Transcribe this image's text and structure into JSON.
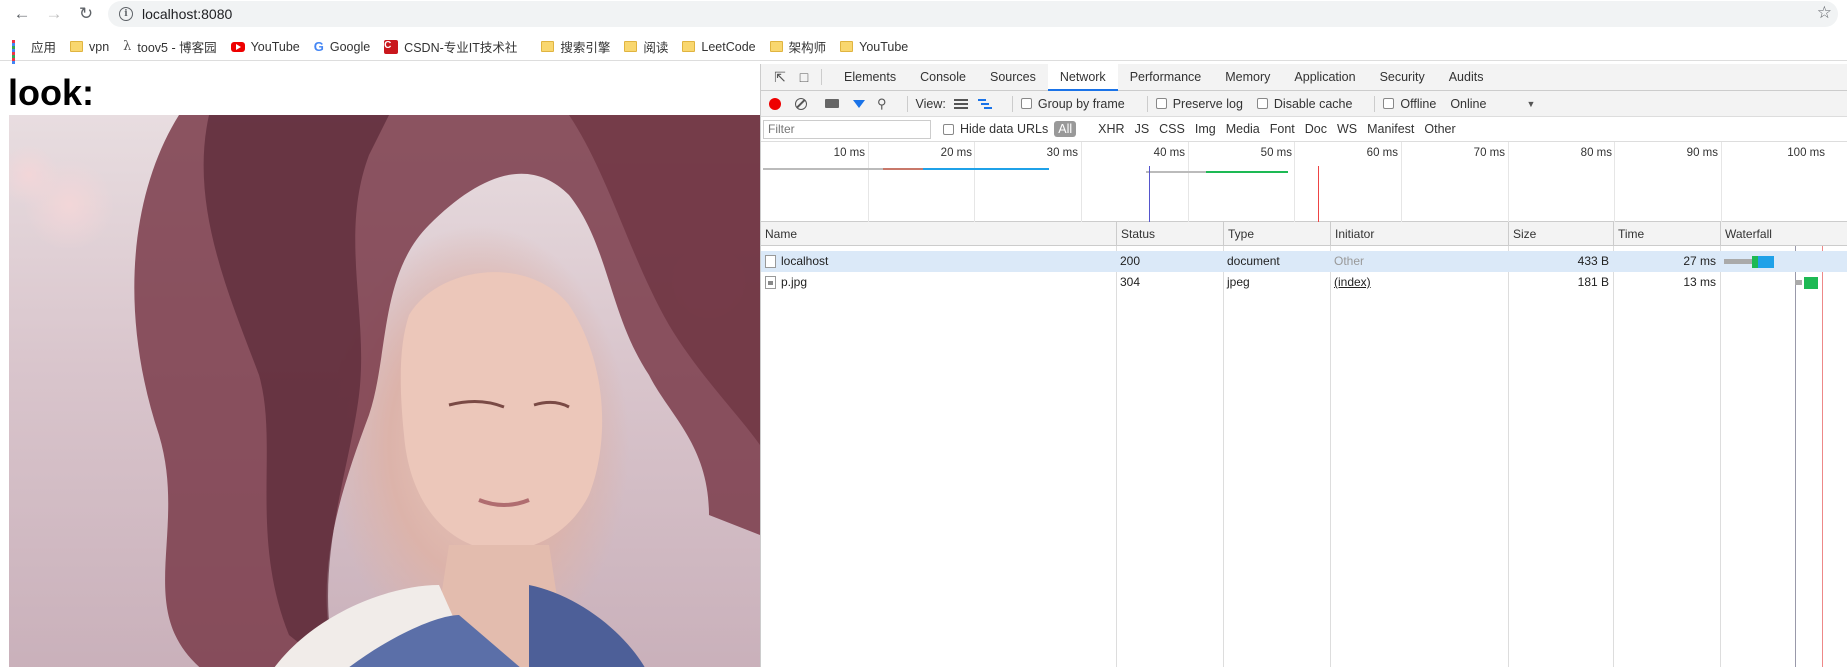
{
  "browser": {
    "url": "localhost:8080",
    "bookmarks": [
      {
        "label": "应用",
        "icon": "apps-icon"
      },
      {
        "label": "vpn",
        "icon": "folder-icon"
      },
      {
        "label": "toov5 - 博客园",
        "icon": "toov-icon"
      },
      {
        "label": "YouTube",
        "icon": "youtube-icon"
      },
      {
        "label": "Google",
        "icon": "google-icon"
      },
      {
        "label": "CSDN-专业IT技术社",
        "icon": "csdn-icon"
      },
      {
        "label": "搜索引擎",
        "icon": "folder-icon"
      },
      {
        "label": "阅读",
        "icon": "folder-icon"
      },
      {
        "label": "LeetCode",
        "icon": "folder-icon"
      },
      {
        "label": "架构师",
        "icon": "folder-icon"
      },
      {
        "label": "YouTube",
        "icon": "folder-icon"
      }
    ]
  },
  "page": {
    "heading": "look:"
  },
  "devtools": {
    "tabs": [
      "Elements",
      "Console",
      "Sources",
      "Network",
      "Performance",
      "Memory",
      "Application",
      "Security",
      "Audits"
    ],
    "active_tab": "Network",
    "controls": {
      "view_label": "View:",
      "group_by_frame": "Group by frame",
      "preserve_log": "Preserve log",
      "disable_cache": "Disable cache",
      "offline": "Offline",
      "throttling": "Online"
    },
    "filter": {
      "placeholder": "Filter",
      "hide_data_urls": "Hide data URLs",
      "types": [
        "All",
        "XHR",
        "JS",
        "CSS",
        "Img",
        "Media",
        "Font",
        "Doc",
        "WS",
        "Manifest",
        "Other"
      ]
    },
    "timeline_ticks": [
      "10 ms",
      "20 ms",
      "30 ms",
      "40 ms",
      "50 ms",
      "60 ms",
      "70 ms",
      "80 ms",
      "90 ms",
      "100 ms"
    ],
    "columns": [
      "Name",
      "Status",
      "Type",
      "Initiator",
      "Size",
      "Time",
      "Waterfall"
    ],
    "rows": [
      {
        "name": "localhost",
        "status": "200",
        "type": "document",
        "initiator": "Other",
        "size": "433 B",
        "time": "27 ms"
      },
      {
        "name": "p.jpg",
        "status": "304",
        "type": "jpeg",
        "initiator": "(index)",
        "size": "181 B",
        "time": "13 ms"
      }
    ],
    "colors": {
      "accent": "#1a73e8",
      "record": "#ee0000",
      "selected_row": "#dbe9f8"
    }
  }
}
